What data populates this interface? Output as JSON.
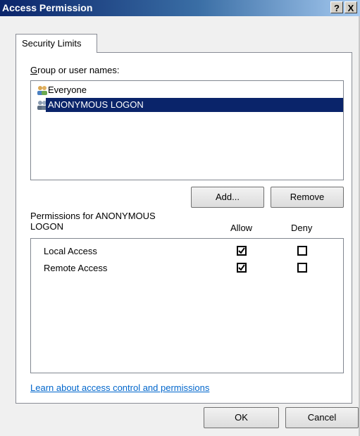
{
  "window": {
    "title": "Access Permission",
    "help_label": "?",
    "close_label": "X"
  },
  "tabs": [
    {
      "label": "Security Limits",
      "selected": true
    }
  ],
  "group_section": {
    "label": "Group or user names:",
    "users": [
      {
        "name": "Everyone",
        "icon": "users-group-icon",
        "selected": false
      },
      {
        "name": "ANONYMOUS LOGON",
        "icon": "users-group-icon",
        "selected": true
      }
    ]
  },
  "buttons": {
    "add": "Add...",
    "remove": "Remove",
    "ok": "OK",
    "cancel": "Cancel"
  },
  "permissions": {
    "label_line1": "Permissions for ANONYMOUS",
    "label_line2": "LOGON",
    "allow_header": "Allow",
    "deny_header": "Deny",
    "rows": [
      {
        "name": "Local Access",
        "allow": true,
        "deny": false
      },
      {
        "name": "Remote Access",
        "allow": true,
        "deny": false
      }
    ]
  },
  "link": {
    "text": "Learn about access control and permissions"
  },
  "colors": {
    "selection": "#0a246a",
    "link": "#0066cc"
  }
}
